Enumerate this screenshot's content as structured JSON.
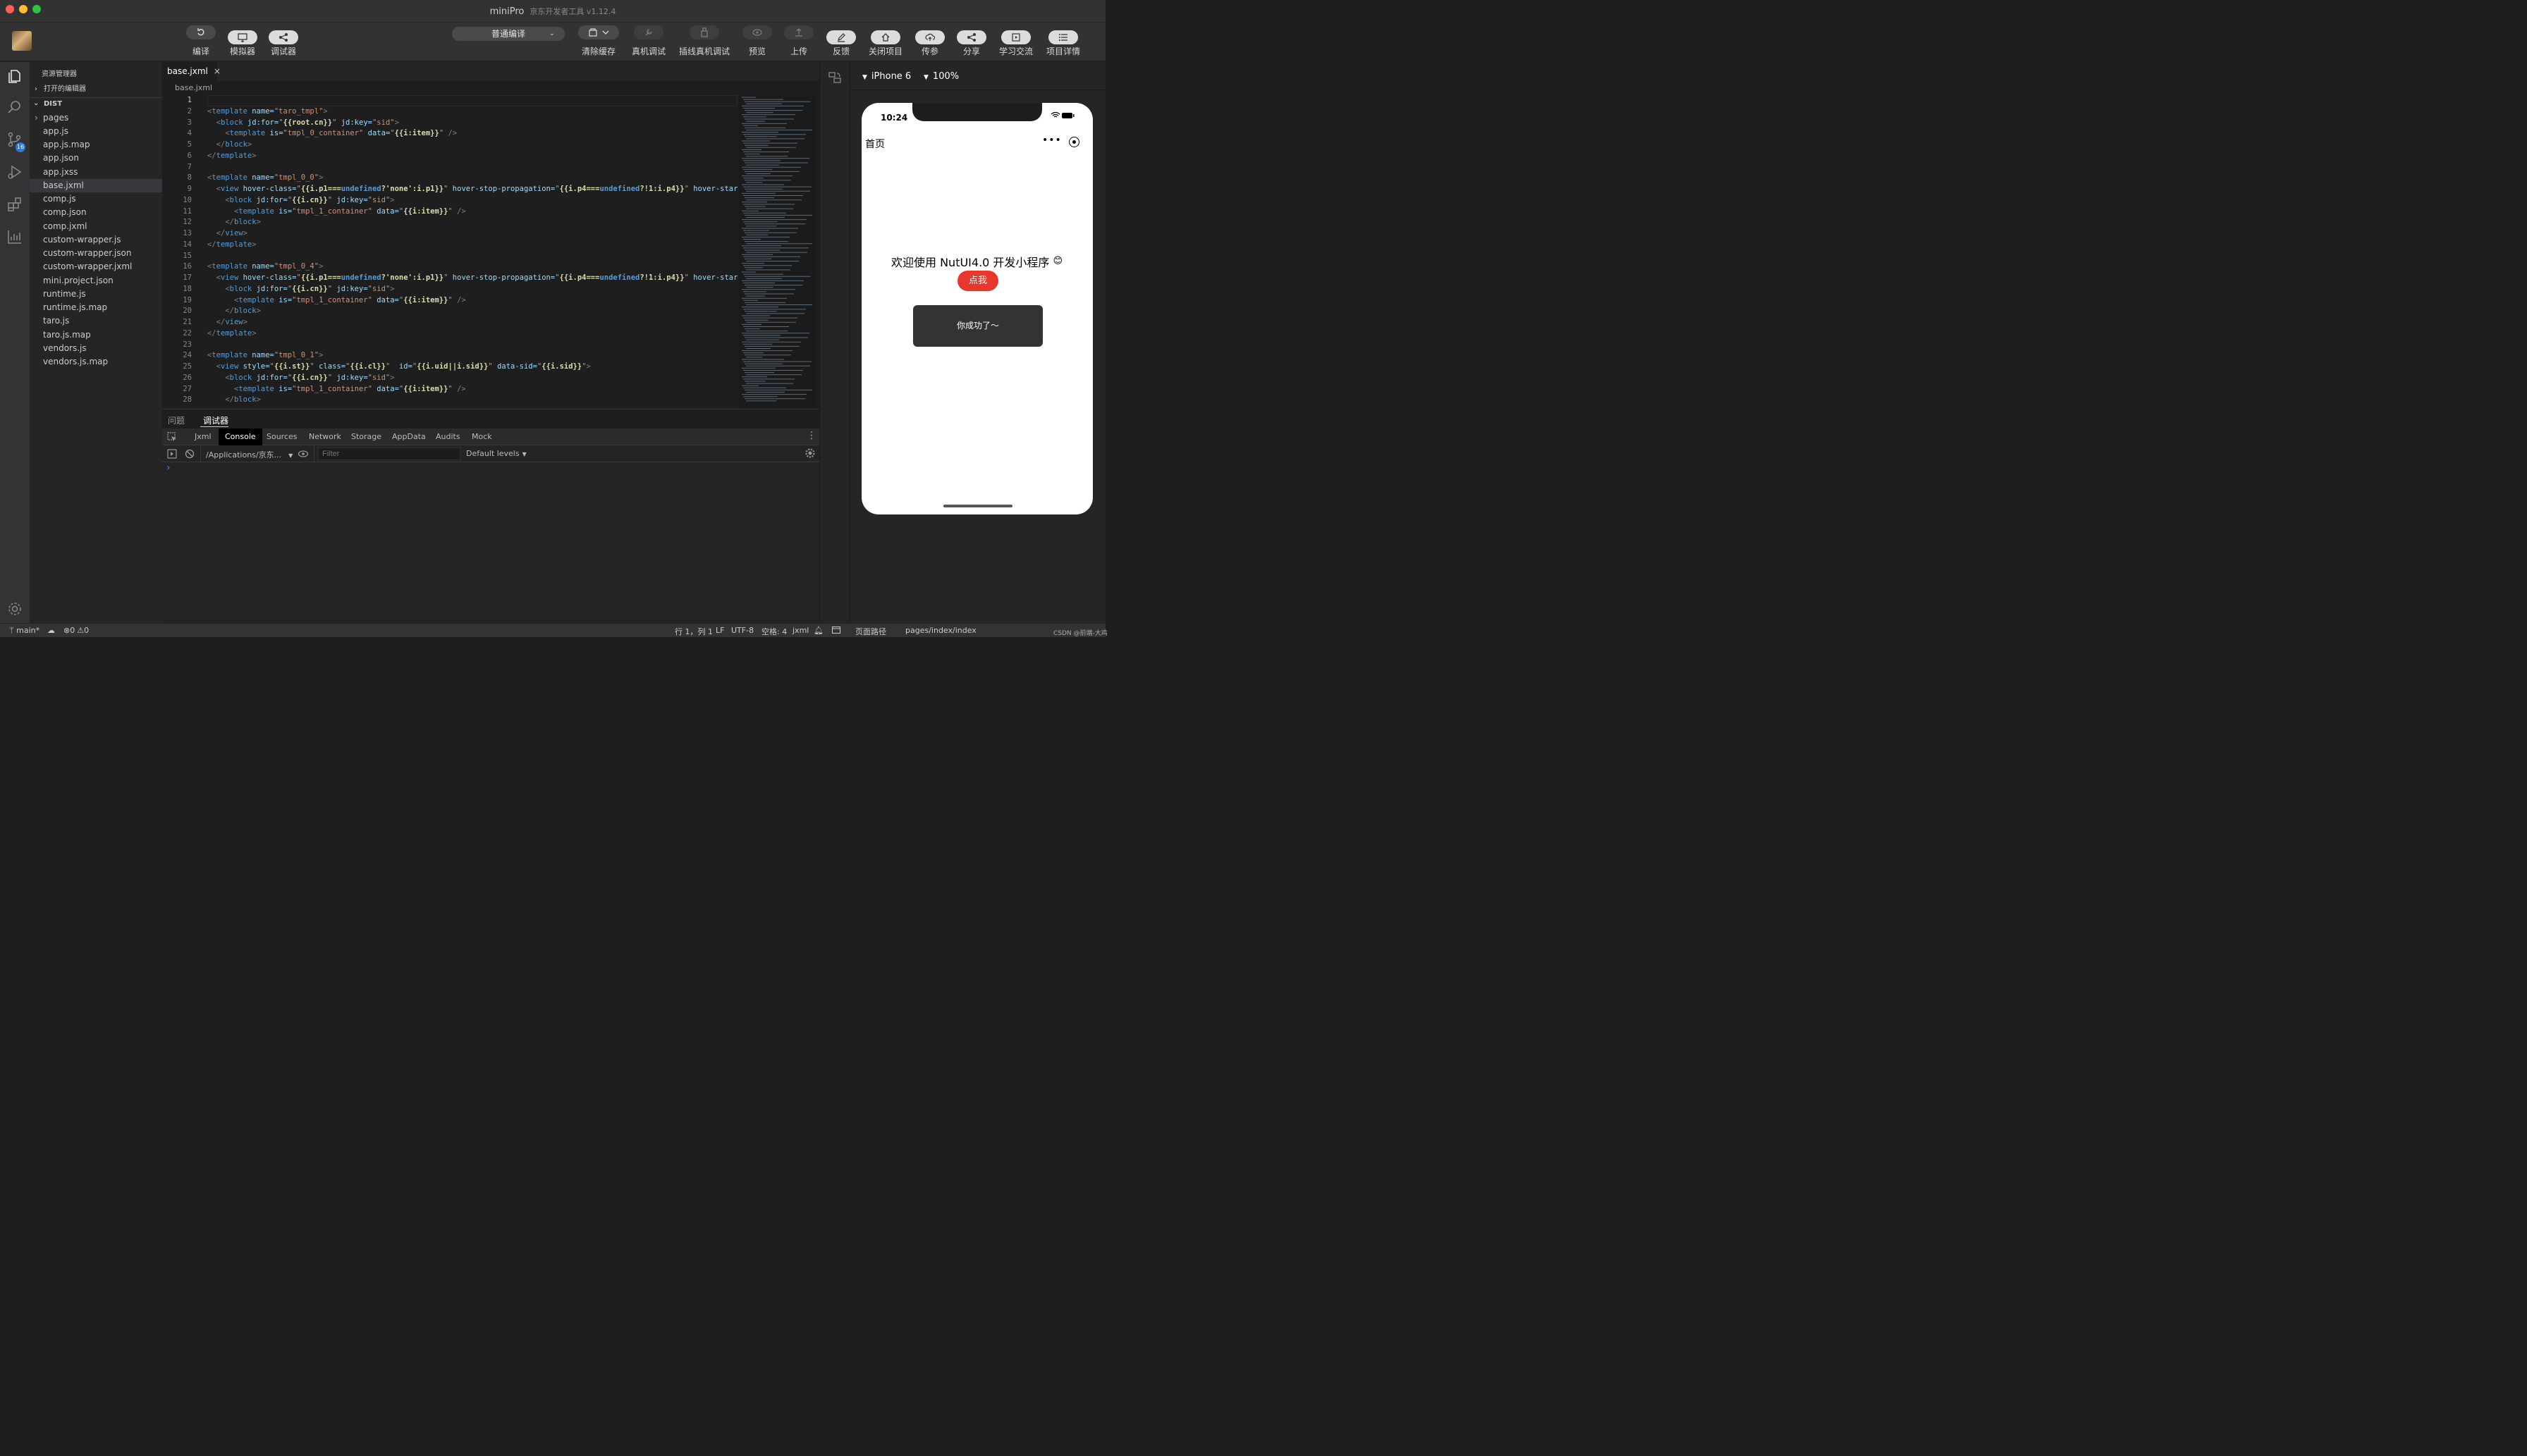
{
  "window": {
    "title": "miniPro",
    "subtitle": "京东开发者工具 v1.12.4"
  },
  "toolbar": {
    "left_buttons": [
      {
        "icon": "refresh-icon",
        "label": "编译"
      },
      {
        "icon": "monitor-icon",
        "label": "模拟器"
      },
      {
        "icon": "share-node-icon",
        "label": "调试器"
      }
    ],
    "compile_mode": "普通编译",
    "right_buttons": [
      {
        "icon": "layers-icon",
        "label": "清除缓存"
      },
      {
        "icon": "wrench-icon",
        "label": "真机调试"
      },
      {
        "icon": "usb-icon",
        "label": "插线真机调试"
      },
      {
        "icon": "eye-icon",
        "label": "预览"
      },
      {
        "icon": "upload-icon",
        "label": "上传"
      },
      {
        "icon": "edit-icon",
        "label": "反馈"
      },
      {
        "icon": "home-icon",
        "label": "关闭项目"
      },
      {
        "icon": "cloud-upload-icon",
        "label": "传参"
      },
      {
        "icon": "share-icon",
        "label": "分享"
      },
      {
        "icon": "play-square-icon",
        "label": "学习交流"
      },
      {
        "icon": "list-icon",
        "label": "项目详情"
      }
    ]
  },
  "explorer": {
    "title": "资源管理器",
    "open_editors": "打开的编辑器",
    "root": "DIST",
    "files": [
      "pages",
      "app.js",
      "app.js.map",
      "app.json",
      "app.jxss",
      "base.jxml",
      "comp.js",
      "comp.json",
      "comp.jxml",
      "custom-wrapper.js",
      "custom-wrapper.json",
      "custom-wrapper.jxml",
      "mini.project.json",
      "runtime.js",
      "runtime.js.map",
      "taro.js",
      "taro.js.map",
      "vendors.js",
      "vendors.js.map"
    ],
    "selected": "base.jxml",
    "scm_badge": "16"
  },
  "editor": {
    "tab": "base.jxml",
    "breadcrumb": "base.jxml",
    "line_numbers": [
      "1",
      "2",
      "3",
      "4",
      "5",
      "6",
      "7",
      "8",
      "9",
      "10",
      "11",
      "12",
      "13",
      "14",
      "15",
      "16",
      "17",
      "18",
      "19",
      "20",
      "21",
      "22",
      "23",
      "24",
      "25",
      "26",
      "27",
      "28"
    ],
    "lines": [
      "",
      "<template name=\"taro_tmpl\">",
      "  <block jd:for=\"{{root.cn}}\" jd:key=\"sid\">",
      "    <template is=\"tmpl_0_container\" data=\"{{i:item}}\" />",
      "  </block>",
      "</template>",
      "",
      "<template name=\"tmpl_0_0\">",
      "  <view hover-class=\"{{i.p1===undefined?'none':i.p1}}\" hover-stop-propagation=\"{{i.p4===undefined?!1:i.p4}}\" hover-star",
      "    <block jd:for=\"{{i.cn}}\" jd:key=\"sid\">",
      "      <template is=\"tmpl_1_container\" data=\"{{i:item}}\" />",
      "    </block>",
      "  </view>",
      "</template>",
      "",
      "<template name=\"tmpl_0_4\">",
      "  <view hover-class=\"{{i.p1===undefined?'none':i.p1}}\" hover-stop-propagation=\"{{i.p4===undefined?!1:i.p4}}\" hover-star",
      "    <block jd:for=\"{{i.cn}}\" jd:key=\"sid\">",
      "      <template is=\"tmpl_1_container\" data=\"{{i:item}}\" />",
      "    </block>",
      "  </view>",
      "</template>",
      "",
      "<template name=\"tmpl_0_1\">",
      "  <view style=\"{{i.st}}\" class=\"{{i.cl}}\"  id=\"{{i.uid||i.sid}}\" data-sid=\"{{i.sid}}\">",
      "    <block jd:for=\"{{i.cn}}\" jd:key=\"sid\">",
      "      <template is=\"tmpl_1_container\" data=\"{{i:item}}\" />",
      "    </block>"
    ]
  },
  "panel": {
    "tabs": [
      "问题",
      "调试器"
    ],
    "devtools_tabs": [
      "Jxml",
      "Console",
      "Sources",
      "Network",
      "Storage",
      "AppData",
      "Audits",
      "Mock"
    ],
    "active_devtools_tab": "Console",
    "context": "/Applications/京东...",
    "filter_placeholder": "Filter",
    "levels": "Default levels",
    "prompt": "›"
  },
  "simulator": {
    "device": "iPhone 6",
    "zoom": "100%",
    "time": "10:24",
    "nav_title": "首页",
    "welcome": "欢迎使用 NutUI4.0 开发小程序",
    "emoji": "😊",
    "button": "点我",
    "toast": "你成功了～"
  },
  "statusbar": {
    "branch": "main*",
    "errors": "0",
    "warnings": "0",
    "position": "行 1，列 1",
    "eol": "LF",
    "encoding": "UTF-8",
    "indent": "空格: 4",
    "language": "jxml",
    "page_path_label": "页面路径",
    "page_path": "pages/index/index",
    "watermark": "CSDN @前端-大鸡"
  },
  "colors": {
    "accent": "#e8372c",
    "toast_bg": "#333333"
  }
}
